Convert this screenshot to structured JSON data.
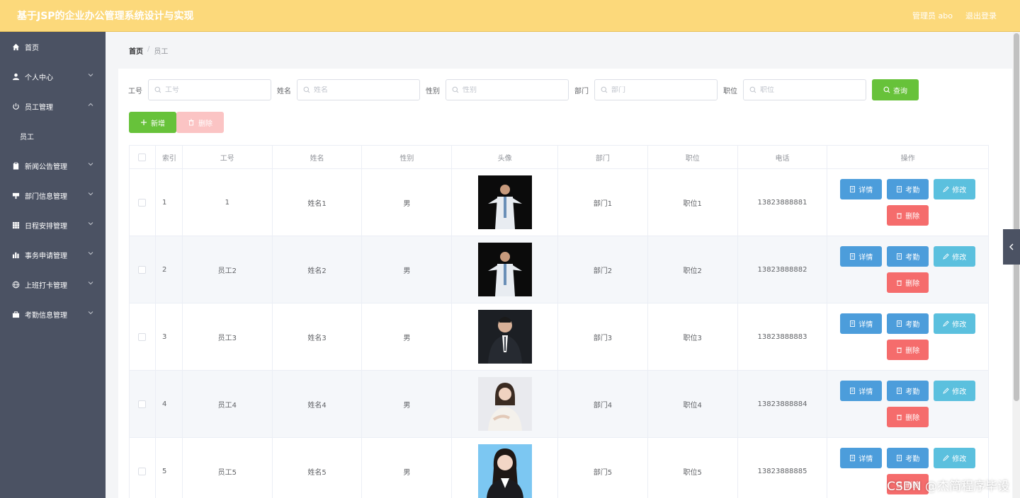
{
  "header": {
    "title": "基于JSP的企业办公管理系统设计与实现",
    "user": "管理员 abo",
    "logout": "退出登录"
  },
  "sidebar": {
    "items": [
      {
        "label": "首页",
        "icon": "home-icon"
      },
      {
        "label": "个人中心",
        "icon": "user-icon"
      },
      {
        "label": "员工管理",
        "icon": "power-icon",
        "sub": "员工"
      },
      {
        "label": "新闻公告管理",
        "icon": "clipboard-icon"
      },
      {
        "label": "部门信息管理",
        "icon": "sign-icon"
      },
      {
        "label": "日程安排管理",
        "icon": "grid-icon"
      },
      {
        "label": "事务申请管理",
        "icon": "chart-icon"
      },
      {
        "label": "上班打卡管理",
        "icon": "globe-icon"
      },
      {
        "label": "考勤信息管理",
        "icon": "briefcase-icon"
      }
    ]
  },
  "breadcrumb": {
    "home": "首页",
    "sep": "/",
    "current": "员工"
  },
  "search": {
    "fields": [
      {
        "label": "工号",
        "placeholder": "工号"
      },
      {
        "label": "姓名",
        "placeholder": "姓名"
      },
      {
        "label": "性别",
        "placeholder": "性别"
      },
      {
        "label": "部门",
        "placeholder": "部门"
      },
      {
        "label": "职位",
        "placeholder": "职位"
      }
    ],
    "query_label": "查询"
  },
  "actions": {
    "add_label": "新增",
    "delete_label": "删除"
  },
  "table": {
    "headers": [
      "索引",
      "工号",
      "姓名",
      "性别",
      "头像",
      "部门",
      "职位",
      "电话",
      "操作"
    ],
    "rows": [
      {
        "index": "1",
        "no": "1",
        "name": "姓名1",
        "sex": "男",
        "dept": "部门1",
        "pos": "职位1",
        "tel": "13823888881"
      },
      {
        "index": "2",
        "no": "员工2",
        "name": "姓名2",
        "sex": "男",
        "dept": "部门2",
        "pos": "职位2",
        "tel": "13823888882"
      },
      {
        "index": "3",
        "no": "员工3",
        "name": "姓名3",
        "sex": "男",
        "dept": "部门3",
        "pos": "职位3",
        "tel": "13823888883"
      },
      {
        "index": "4",
        "no": "员工4",
        "name": "姓名4",
        "sex": "男",
        "dept": "部门4",
        "pos": "职位4",
        "tel": "13823888884"
      },
      {
        "index": "5",
        "no": "员工5",
        "name": "姓名5",
        "sex": "男",
        "dept": "部门5",
        "pos": "职位5",
        "tel": "13823888885"
      }
    ],
    "ops": {
      "detail": "详情",
      "attend": "考勤",
      "edit": "修改",
      "delete": "删除"
    }
  },
  "watermark": "CSDN @杰简程序毕设",
  "colors": {
    "header": "#fcd97b",
    "sidebar": "#4b5263",
    "success": "#67c23a",
    "primary": "#4c9ddb",
    "info": "#5bc0de",
    "danger": "#f56c6c"
  }
}
